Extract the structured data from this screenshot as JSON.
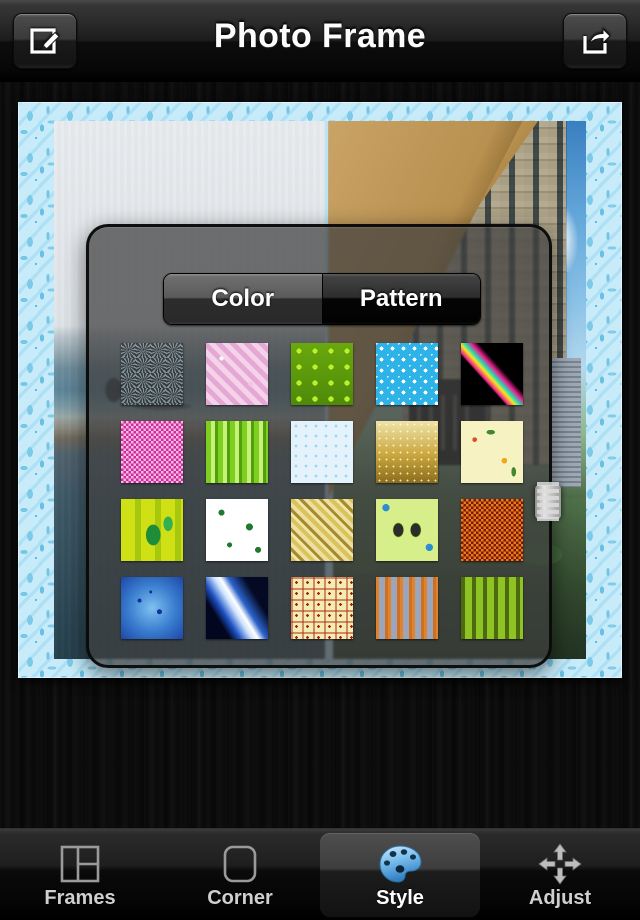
{
  "header": {
    "title": "Photo Frame",
    "left_button": {
      "name": "compose-button",
      "icon": "compose-icon"
    },
    "right_button": {
      "name": "share-button",
      "icon": "share-icon"
    }
  },
  "popup": {
    "segmented": {
      "selected": "Color",
      "options": [
        {
          "label": "Color",
          "selected": true
        },
        {
          "label": "Pattern",
          "selected": false
        }
      ]
    },
    "knob": {
      "name": "resize-knob"
    },
    "patterns": [
      {
        "index": 1,
        "name": "geometric-tile-gray",
        "css": "repeating-conic-gradient(from 45deg at 50% 50%, rgba(190,215,225,.55) 0deg 12deg, rgba(40,44,46,.25) 12deg 28deg) 0 0/15px 15px, rgba(46,50,52,.55)"
      },
      {
        "index": 2,
        "name": "pink-damask",
        "css": "radial-gradient(circle 5px at 25% 25%, #fff 40%, transparent 42%), radial-gradient(circle 6px at 72% 66%, #f2c7e4 40%, transparent 42%), repeating-linear-gradient(45deg,#e5a8d4 0 5px,#f4d3ea 5px 10px), #ecbcdf"
      },
      {
        "index": 3,
        "name": "green-floral-blocks",
        "css": "radial-gradient(circle 6px at 50% 50%, #b8f02a 45%, #3d7a0a 48%, #2f6106 52%, transparent 54%) 0 0/16px 16px, linear-gradient(#6aa80e,#4e8a08)"
      },
      {
        "index": 4,
        "name": "blue-dot-lattice",
        "css": "radial-gradient(circle 4px at 50% 50%, #ffffff 45%, transparent 48%) 0 0/11px 11px, radial-gradient(circle 4px at 0 0, #cdeffc 45%, transparent 48%) 0 0/11px 11px, #2eb3e8"
      },
      {
        "index": 5,
        "name": "neon-sparkle-dark",
        "css": "linear-gradient(48deg, rgba(0,0,0,1) 0 38%, #e81f8c 40%, #ffe21f 46%, #24e0b5 50%, #e81f8c 56%, rgba(0,0,0,1) 62% 100%), #000"
      },
      {
        "index": 6,
        "name": "magenta-noise",
        "css": "repeating-conic-gradient(#cf2a9c 0% 25%, #f5b9e2 0% 50%) 0 0/5px 5px, #d632a4"
      },
      {
        "index": 7,
        "name": "green-plaid",
        "css": "repeating-linear-gradient(to right,#7ed020 0 5px,#c8f07a 5px 9px,#4fa00c 9px 12px), repeating-linear-gradient(to bottom,rgba(90,170,15,.6) 0 5px,rgba(210,245,150,.55) 5px 9px,rgba(60,130,10,.6) 9px 12px)"
      },
      {
        "index": 8,
        "name": "pale-blue-dots",
        "css": "radial-gradient(circle 3px at 50% 50%, #9fd4ee 45%, transparent 48%) 0 0/10px 10px, #e4f3fb"
      },
      {
        "index": 9,
        "name": "gold-gradient-dots",
        "css": "radial-gradient(circle 2px at 50% 50%, rgba(255,250,210,.85) 45%, transparent 48%) 0 0/7px 7px, linear-gradient(to bottom,#efe3a8,#c9a63e 55%,#8b6d1c)"
      },
      {
        "index": 10,
        "name": "cream-floral",
        "css": "radial-gradient(circle 5px at 22% 30%, #e04a2a 45%, transparent 48%), radial-gradient(circle 6px at 70% 64%, #f2a81c 45%, transparent 48%), radial-gradient(ellipse 9px 5px at 48% 18%, #3f8a2c 45%, transparent 48%), radial-gradient(ellipse 5px 10px at 85% 82%, #3f8a2c 45%, transparent 48%), #f6f2c2"
      },
      {
        "index": 11,
        "name": "green-leaf-tile",
        "css": "radial-gradient(ellipse 14px 20px at 52% 58%, #1f8c3a 50%, transparent 54%), radial-gradient(ellipse 9px 14px at 76% 40%, #35b050 50%, transparent 54%), repeating-linear-gradient(to right,#cfe015 0 14px,#a7c80c 14px 20px), #bcd312"
      },
      {
        "index": 12,
        "name": "white-green-splat",
        "css": "radial-gradient(circle 6px at 25% 22%, #1f7a2e 48%, transparent 52%), radial-gradient(circle 7px at 70% 45%, #1f7a2e 48%, transparent 52%), radial-gradient(circle 5px at 38% 74%, #1f7a2e 48%, transparent 52%), radial-gradient(circle 6px at 84% 82%, #1f7a2e 48%, transparent 52%), #ffffff"
      },
      {
        "index": 13,
        "name": "diagonal-gold-stripes",
        "css": "repeating-linear-gradient(45deg,#d9c35a 0 4px,#f0e6a8 4px 7px,#a88a2e 7px 10px,#eddfa0 10px 14px), #cdb55a"
      },
      {
        "index": 14,
        "name": "butterfly-green",
        "css": "radial-gradient(ellipse 12px 16px at 36% 50%, #2c2c2c 40%, #8ed11a 44%, transparent 48%), radial-gradient(ellipse 12px 16px at 64% 50%, #2c2c2c 40%, #8ed11a 44%, transparent 48%), radial-gradient(circle 7px at 16% 14%, #2a8ed0 50%, transparent 54%), radial-gradient(circle 7px at 86% 78%, #2a8ed0 50%, transparent 54%), #d7ef8a"
      },
      {
        "index": 15,
        "name": "red-gold-speckle",
        "css": "repeating-conic-gradient(#8b1008 0% 25%, #d6851a 0% 50%) 0 0/5px 5px, #8d1109"
      },
      {
        "index": 16,
        "name": "blue-starburst",
        "css": "radial-gradient(circle 4px at 30% 38%, #0e2f9c 48%, transparent 52%), radial-gradient(circle 5px at 62% 56%, #10349f 48%, transparent 52%), radial-gradient(circle 3px at 48% 24%, #0e2f9c 48%, transparent 52%), radial-gradient(ellipse at 50% 50%, #7fc1ef 0%, #3b7fd0 52%, #1b47a8 100%)"
      },
      {
        "index": 17,
        "name": "blue-light-streaks",
        "css": "linear-gradient(58deg, #02061f 0 24%, #1d52c4 34%, #cfe4ff 46%, #ffffff 52%, #2c63cc 60%, #040a24 76%)"
      },
      {
        "index": 18,
        "name": "cream-red-dots-grid",
        "css": "radial-gradient(circle 3px at 50% 50%, #a81f14 45%, transparent 48%) 0 0/11px 11px, repeating-linear-gradient(to right,rgba(180,40,25,.5) 0 2px,transparent 2px 11px), repeating-linear-gradient(to bottom,rgba(180,40,25,.5) 0 2px,transparent 2px 11px), #f2edb0"
      },
      {
        "index": 19,
        "name": "orange-blue-plaid",
        "css": "repeating-linear-gradient(to right,#e0832a 0 3px,#9aa6bd 3px 9px,#cf6f22 9px 12px), repeating-linear-gradient(to bottom,rgba(224,131,42,.55) 0 3px,rgba(154,166,189,.5) 3px 9px,rgba(207,111,34,.55) 9px 12px)"
      },
      {
        "index": 20,
        "name": "olive-green-plaid",
        "css": "repeating-linear-gradient(to right,#4c6b10 0 4px,#8fc223 4px 11px), repeating-linear-gradient(to bottom,rgba(76,107,16,.62) 0 4px,rgba(143,194,35,.5) 4px 11px)"
      }
    ]
  },
  "frame": {
    "border_color": "#c8ecfa",
    "border_accent": "#6fc3e5",
    "photos": [
      {
        "name": "photo-beach",
        "description": "beach and ocean"
      },
      {
        "name": "photo-building",
        "description": "apartment building and sky"
      }
    ]
  },
  "tabbar": {
    "items": [
      {
        "label": "Frames",
        "icon": "grid-layout-icon",
        "active": false
      },
      {
        "label": "Corner",
        "icon": "rounded-square-icon",
        "active": false
      },
      {
        "label": "Style",
        "icon": "palette-icon",
        "active": true
      },
      {
        "label": "Adjust",
        "icon": "move-arrows-icon",
        "active": false
      }
    ]
  },
  "colors": {
    "accent_blue": "#5bb8e8",
    "panel_bg": "rgba(62,62,62,0.72)",
    "wood": "#0b0b0b"
  }
}
